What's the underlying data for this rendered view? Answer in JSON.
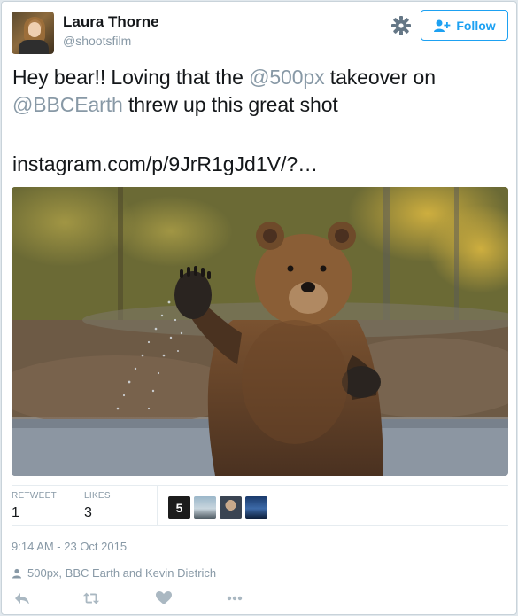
{
  "user": {
    "name": "Laura Thorne",
    "handle": "@shootsfilm"
  },
  "header": {
    "follow_label": "Follow"
  },
  "tweet": {
    "text_pre": "Hey bear!! Loving that the ",
    "mention1": "@500px",
    "text_mid": " takeover on ",
    "mention2": "@BBCEarth",
    "text_post": " threw up this great shot",
    "link": "instagram.com/p/9JrR1gJd1V/?…"
  },
  "stats": {
    "retweet_label": "RETWEET",
    "retweet_count": "1",
    "likes_label": "LIKES",
    "likes_count": "3"
  },
  "timestamp": "9:14 AM - 23 Oct 2015",
  "tagged": "500px, BBC Earth and Kevin Dietrich",
  "colors": {
    "accent": "#1da1f2",
    "muted": "#8899a6",
    "text": "#14171a"
  },
  "icons": [
    "gear-icon",
    "follow-person-plus-icon",
    "reply-icon",
    "retweet-icon",
    "like-heart-icon",
    "more-dots-icon",
    "person-icon"
  ]
}
